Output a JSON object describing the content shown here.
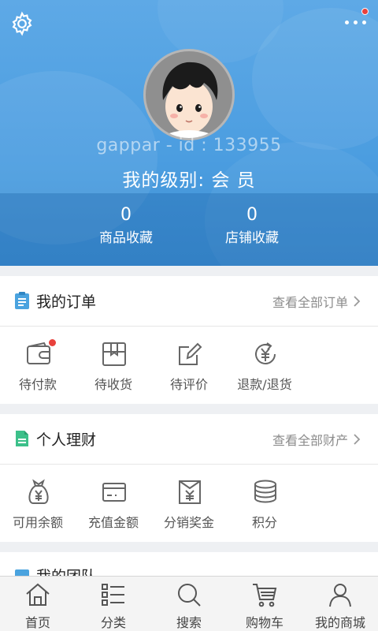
{
  "header": {
    "username": "gappar - id : 133955",
    "level": "我的级别: 会 员",
    "favorites": [
      {
        "count": "0",
        "label": "商品收藏"
      },
      {
        "count": "0",
        "label": "店铺收藏"
      }
    ]
  },
  "orders": {
    "title": "我的订单",
    "view_all": "查看全部订单",
    "items": [
      {
        "label": "待付款",
        "icon": "wallet-icon",
        "badge": true
      },
      {
        "label": "待收货",
        "icon": "box-icon"
      },
      {
        "label": "待评价",
        "icon": "edit-icon"
      },
      {
        "label": "退款/退货",
        "icon": "refund-icon"
      }
    ]
  },
  "finance": {
    "title": "个人理财",
    "view_all": "查看全部财产",
    "items": [
      {
        "label": "可用余额",
        "icon": "money-bag-icon"
      },
      {
        "label": "充值金额",
        "icon": "card-icon"
      },
      {
        "label": "分销奖金",
        "icon": "bonus-envelope-icon"
      },
      {
        "label": "积分",
        "icon": "coins-icon"
      }
    ]
  },
  "team": {
    "title": "我的团队"
  },
  "bottom_nav": [
    {
      "label": "首页",
      "icon": "home-icon"
    },
    {
      "label": "分类",
      "icon": "category-icon"
    },
    {
      "label": "搜索",
      "icon": "search-icon"
    },
    {
      "label": "购物车",
      "icon": "cart-icon"
    },
    {
      "label": "我的商城",
      "icon": "user-icon"
    }
  ],
  "colors": {
    "header_blue": "#4b9de0",
    "badge_red": "#e8413c",
    "icon_gray": "#666666",
    "orders_icon": "#4aa3df",
    "finance_icon": "#3cc08a"
  }
}
